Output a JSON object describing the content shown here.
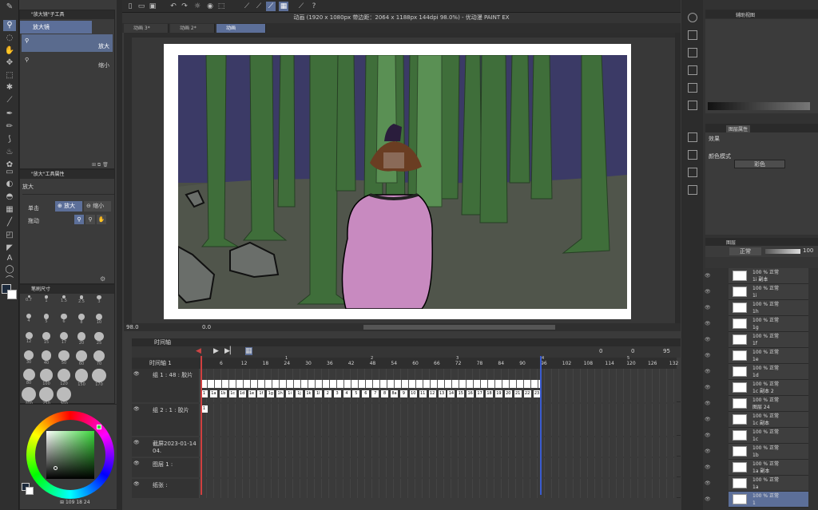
{
  "window": {
    "title": "动画 (1920 x 1080px 带边距：2064 x 1188px 144dpi 98.0%) - 优动漫 PAINT EX",
    "tabs": [
      {
        "label": "动画 3*"
      },
      {
        "label": "动画 2*"
      },
      {
        "label": "动画"
      }
    ]
  },
  "sub_tool_panel": {
    "title": "\"放大镜\"子工具",
    "items": [
      {
        "label": "放大镜"
      },
      {
        "label": "放大"
      },
      {
        "label": "缩小"
      }
    ]
  },
  "tool_property_panel": {
    "title": "\"放大\"工具属性",
    "name": "放大",
    "click_label": "单击",
    "zoom_in_label": "放大",
    "zoom_out_label": "缩小",
    "drag_label": "拖动"
  },
  "brush_size_panel": {
    "title": "笔刷尺寸",
    "sizes": [
      "0.7",
      "1",
      "1.5",
      "2.5",
      "3",
      "4",
      "5",
      "6",
      "8",
      "10",
      "12",
      "15",
      "17",
      "20",
      "25",
      "30",
      "40",
      "50",
      "60",
      "70",
      "80",
      "100",
      "120",
      "150",
      "170",
      "200",
      "250",
      "300"
    ]
  },
  "color_panel": {
    "rgb_readout": [
      "109",
      "18",
      "24"
    ]
  },
  "status_bar": {
    "zoom": "98.0",
    "rotation": "0.0"
  },
  "timeline": {
    "title": "时间轴",
    "timeline_name": "时间轴 1",
    "counters": [
      "0",
      "0",
      "95"
    ],
    "ruler_numbers": [
      "6",
      "12",
      "18",
      "24",
      "30",
      "36",
      "42",
      "48",
      "54",
      "60",
      "66",
      "72",
      "78",
      "84",
      "90",
      "96",
      "102",
      "108",
      "114",
      "120",
      "126",
      "132"
    ],
    "second_markers": [
      "1",
      "2",
      "3",
      "4",
      "5"
    ],
    "tracks": [
      {
        "name": "组 1 : 48 : 胶片",
        "cells": [
          "1",
          "1a",
          "1b",
          "1c",
          "1d",
          "1e",
          "1f",
          "1g",
          "1h",
          "1i",
          "1j",
          "1k",
          "1l",
          "2",
          "3",
          "4",
          "5",
          "6",
          "7",
          "8",
          "8a",
          "9",
          "10",
          "11",
          "12",
          "13",
          "14",
          "15",
          "16",
          "17",
          "18",
          "19",
          "20",
          "21",
          "22",
          "23"
        ]
      },
      {
        "name": "组 2 : 1 : 胶片",
        "cells": [
          "1"
        ]
      },
      {
        "name": "截屏2023-01-14 04.",
        "cells": []
      },
      {
        "name": "图层 1 :",
        "cells": []
      },
      {
        "name": "纸张 :",
        "cells": []
      }
    ]
  },
  "right_panel": {
    "nav_title": "辅助视图",
    "layer_property_title": "图层属性",
    "effect_label": "效果",
    "color_mode_label": "颜色模式",
    "color_mode_value": "彩色",
    "layer_title": "图层",
    "blend_mode": "正常",
    "opacity": "100",
    "layers": [
      {
        "pct": "100 %",
        "mode": "正常",
        "name": "1i 副本"
      },
      {
        "pct": "100 %",
        "mode": "正常",
        "name": "1i"
      },
      {
        "pct": "100 %",
        "mode": "正常",
        "name": "1h"
      },
      {
        "pct": "100 %",
        "mode": "正常",
        "name": "1g"
      },
      {
        "pct": "100 %",
        "mode": "正常",
        "name": "1f"
      },
      {
        "pct": "100 %",
        "mode": "正常",
        "name": "1e"
      },
      {
        "pct": "100 %",
        "mode": "正常",
        "name": "1d"
      },
      {
        "pct": "100 %",
        "mode": "正常",
        "name": "1c 副本 2"
      },
      {
        "pct": "100 %",
        "mode": "正常",
        "name": "图层 24"
      },
      {
        "pct": "100 %",
        "mode": "正常",
        "name": "1c 副本"
      },
      {
        "pct": "100 %",
        "mode": "正常",
        "name": "1c"
      },
      {
        "pct": "100 %",
        "mode": "正常",
        "name": "1b"
      },
      {
        "pct": "100 %",
        "mode": "正常",
        "name": "1a 副本"
      },
      {
        "pct": "100 %",
        "mode": "正常",
        "name": "1a"
      },
      {
        "pct": "100 %",
        "mode": "正常",
        "name": "1"
      }
    ]
  },
  "colors": {
    "accent": "#5c6f99",
    "sky": "#3b3a66",
    "tree": "#3f6e3a",
    "coat": "#c88ac0"
  }
}
